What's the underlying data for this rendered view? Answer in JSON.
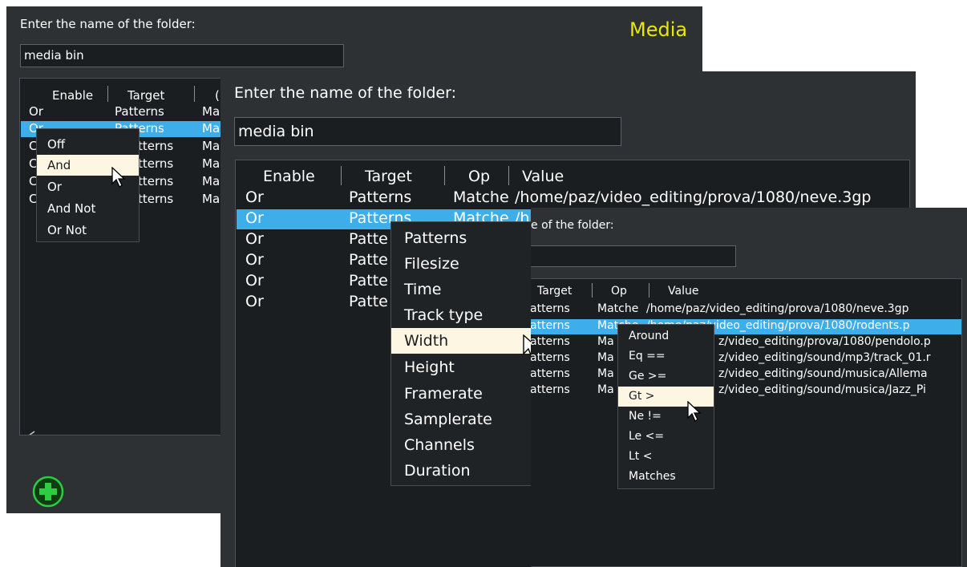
{
  "colors": {
    "panel": "#2e3134",
    "field": "#1b1e20",
    "selection": "#3daee9",
    "highlight": "#fdf6e3",
    "accent_title": "#e8e800",
    "add_icon": "#2ecc40"
  },
  "w1": {
    "prompt": "Enter the name of the folder:",
    "title": "Media",
    "input_value": "media bin",
    "headers": [
      "Enable",
      "Target",
      "("
    ],
    "rows": [
      [
        "Or",
        "Patterns",
        "Ma"
      ],
      [
        "Or",
        "Patterns",
        "Ma"
      ],
      [
        "C",
        "tterns",
        "Ma"
      ],
      [
        "C",
        "tterns",
        "Ma"
      ],
      [
        "C",
        "tterns",
        "Ma"
      ],
      [
        "C",
        "tterns",
        "Ma"
      ]
    ],
    "menu": [
      "Off",
      "And",
      "Or",
      "And Not",
      "Or Not"
    ],
    "menu_selected": "And",
    "add_icon": "add-circle-icon"
  },
  "w2": {
    "prompt": "Enter the name of the folder:",
    "input_value": "media bin",
    "headers": [
      "Enable",
      "Target",
      "Op",
      "Value"
    ],
    "rows": [
      [
        "Or",
        "Patterns",
        "Matche",
        "/home/paz/video_editing/prova/1080/neve.3gp"
      ],
      [
        "Or",
        "Patterns",
        "Matche",
        "/h"
      ],
      [
        "Or",
        "Patte",
        "",
        ""
      ],
      [
        "Or",
        "Patte",
        "",
        ""
      ],
      [
        "Or",
        "Patte",
        "",
        ""
      ],
      [
        "Or",
        "Patte",
        "",
        ""
      ]
    ],
    "menu": [
      "Patterns",
      "Filesize",
      "Time",
      "Track type",
      "Width",
      "Height",
      "Framerate",
      "Samplerate",
      "Channels",
      "Duration"
    ],
    "menu_selected": "Width"
  },
  "w3": {
    "prompt": "e of the folder:",
    "headers": [
      "Target",
      "Op",
      "Value"
    ],
    "rows": [
      [
        "atterns",
        "Matche",
        "/home/paz/video_editing/prova/1080/neve.3gp"
      ],
      [
        "atterns",
        "Matche",
        "/home/paz/video_editing/prova/1080/rodents.p"
      ],
      [
        "atterns",
        "Ma",
        "z/video_editing/prova/1080/pendolo.p"
      ],
      [
        "atterns",
        "Ma",
        "z/video_editing/sound/mp3/track_01.r"
      ],
      [
        "atterns",
        "Ma",
        "z/video_editing/sound/musica/Allema"
      ],
      [
        "atterns",
        "Ma",
        "z/video_editing/sound/musica/Jazz_Pi"
      ]
    ],
    "menu": [
      "Around",
      "Eq  ==",
      "Ge  >=",
      "Gt  >",
      "Ne  !=",
      "Le  <=",
      "Lt  <",
      "Matches"
    ],
    "menu_selected": "Gt  >"
  }
}
